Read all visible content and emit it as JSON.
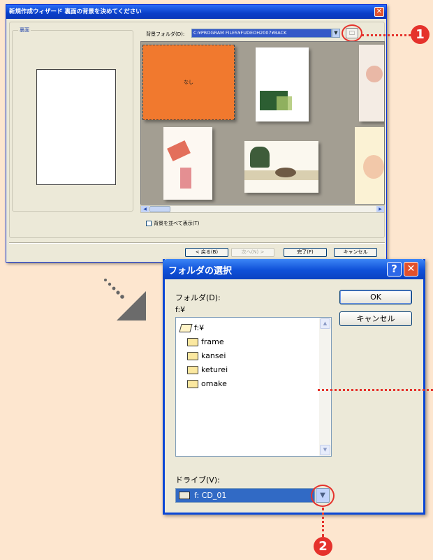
{
  "wizard": {
    "title": "新規作成ウィザード 裏面の背景を決めてください",
    "group_label": "裏面",
    "folder_label": "背景フォルダ(D):",
    "folder_path": "C:¥PROGRAM FILES¥FUDEOH2007¥BACK",
    "none_thumb_label": "なし",
    "show_all_label": "背景を並べて表示(T)",
    "buttons": {
      "back": "< 戻る(B)",
      "next": "次へ(N) >",
      "finish": "完了(F)",
      "cancel": "キャンセル"
    }
  },
  "picker": {
    "title": "フォルダの選択",
    "folder_label": "フォルダ(D):",
    "current_path": "f:¥",
    "ok_label": "OK",
    "cancel_label": "キャンセル",
    "tree": [
      {
        "label": "f:¥",
        "open": true
      },
      {
        "label": "frame"
      },
      {
        "label": "kansei"
      },
      {
        "label": "keturei"
      },
      {
        "label": "omake"
      }
    ],
    "drive_label": "ドライブ(V):",
    "drive_value": "f: CD_01"
  },
  "annotations": {
    "badge1": "1",
    "badge2": "2"
  },
  "colors": {
    "page_bg": "#fde6cf",
    "accent_red": "#e5322c",
    "title_blue": "#0a47d6"
  }
}
